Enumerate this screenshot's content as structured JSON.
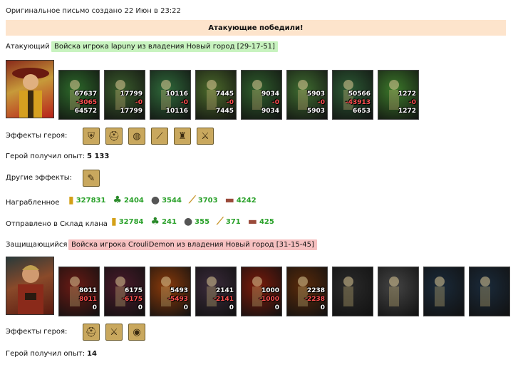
{
  "header": {
    "created": "Оригинальное письмо создано 22 Июн  в 23:22"
  },
  "banner": {
    "text": "Атакующие победили!"
  },
  "attacker": {
    "label": "Атакующий",
    "tag": "Войска игрока lapuny из владения Новый город [29-17-51]",
    "units": [
      {
        "a": "67637",
        "b": "-3065",
        "c": "64572",
        "color": "#2d6a2a"
      },
      {
        "a": "17799",
        "b": "-0",
        "c": "17799",
        "color": "#3a5d2c"
      },
      {
        "a": "10116",
        "b": "-0",
        "c": "10116",
        "color": "#2f6a3a"
      },
      {
        "a": "7445",
        "b": "-0",
        "c": "7445",
        "color": "#4c6b2b"
      },
      {
        "a": "9034",
        "b": "-0",
        "c": "9034",
        "color": "#2f5f2c"
      },
      {
        "a": "5903",
        "b": "-0",
        "c": "5903",
        "color": "#3f6d30"
      },
      {
        "a": "50566",
        "b": "-43913",
        "c": "6653",
        "color": "#2c5b34"
      },
      {
        "a": "1272",
        "b": "-0",
        "c": "1272",
        "color": "#3c7a2a"
      }
    ],
    "effects_label": "Эффекты героя:",
    "effects": [
      "shield-icon",
      "helmet-icon",
      "bag-icon",
      "wand-icon",
      "fortress-icon",
      "sword-icon"
    ],
    "exp_label": "Герой получил опыт:",
    "exp_value": "5 133",
    "other_label": "Другие эффекты:",
    "other_effects": [
      "scroll-icon"
    ],
    "loot_label": "Награбленное",
    "loot": [
      {
        "icon": "gold-icon",
        "value": "327831"
      },
      {
        "icon": "wood-icon",
        "value": "2404"
      },
      {
        "icon": "ore-icon",
        "value": "3544"
      },
      {
        "icon": "grain-icon",
        "value": "3703"
      },
      {
        "icon": "stone-icon",
        "value": "4242"
      }
    ],
    "clan_label": "Отправлено в Склад клана",
    "clan": [
      {
        "icon": "gold-icon",
        "value": "32784"
      },
      {
        "icon": "wood-icon",
        "value": "241"
      },
      {
        "icon": "ore-icon",
        "value": "355"
      },
      {
        "icon": "grain-icon",
        "value": "371"
      },
      {
        "icon": "stone-icon",
        "value": "425"
      }
    ]
  },
  "defender": {
    "label": "Защищающийся",
    "tag": "Войска игрока CrouliDemon из владения Новый город [31-15-45]",
    "units": [
      {
        "a": "8011",
        "b": "8011",
        "c": "0",
        "color": "#6a1a14"
      },
      {
        "a": "6175",
        "b": "-6175",
        "c": "0",
        "color": "#4a1a2a"
      },
      {
        "a": "5493",
        "b": "-5493",
        "c": "0",
        "color": "#8a3a0a"
      },
      {
        "a": "2141",
        "b": "-2141",
        "c": "0",
        "color": "#3a2a3a"
      },
      {
        "a": "1000",
        "b": "-1000",
        "c": "0",
        "color": "#7a1a0a"
      },
      {
        "a": "2238",
        "b": "-2238",
        "c": "0",
        "color": "#5a2a0a"
      },
      {
        "a": "",
        "b": "",
        "c": "",
        "color": "#2a2a2a"
      },
      {
        "a": "",
        "b": "",
        "c": "",
        "color": "#444444"
      },
      {
        "a": "",
        "b": "",
        "c": "",
        "color": "#1a2a3a"
      },
      {
        "a": "",
        "b": "",
        "c": "",
        "color": "#1a2a3a"
      }
    ],
    "effects_label": "Эффекты героя:",
    "effects": [
      "helmet-icon",
      "sword-icon",
      "amulet-icon"
    ],
    "exp_label": "Герой получил опыт:",
    "exp_value": "14"
  }
}
